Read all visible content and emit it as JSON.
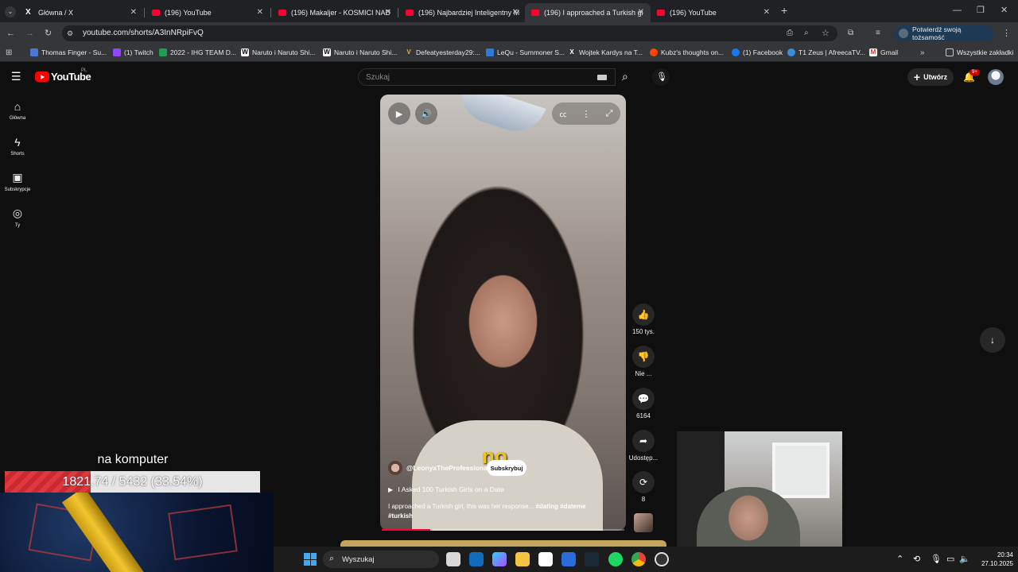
{
  "browser": {
    "tabs": [
      {
        "label": "Główna / X",
        "icon": "x-logo-icon"
      },
      {
        "label": "(196) YouTube",
        "icon": "youtube-icon"
      },
      {
        "label": "(196) Makaljer - KOSMICI NAD",
        "icon": "youtube-icon"
      },
      {
        "label": "(196) Najbardziej Inteligentny M",
        "icon": "youtube-icon"
      },
      {
        "label": "(196) I approached a Turkish gi",
        "icon": "youtube-icon",
        "active": true
      },
      {
        "label": "(196) YouTube",
        "icon": "youtube-icon"
      }
    ],
    "new_tab": "+",
    "url": "youtube.com/shorts/A3InNRpiFvQ",
    "verify_identity": "Potwierdź swoją tożsamość",
    "bookmarks": [
      "Thomas Finger - Su...",
      "(1) Twitch",
      "2022 - IHG TEAM D...",
      "Naruto i Naruto Shi...",
      "Naruto i Naruto Shi...",
      "Defeatyesterday29:...",
      "LeQu - Summoner S...",
      "Wojtek Kardys na T...",
      "Kubz's thoughts on...",
      "(1) Facebook",
      "T1 Zeus | AfreecaTV...",
      "Gmail"
    ],
    "all_bookmarks": "Wszystkie zakładki"
  },
  "youtube": {
    "logo_text": "YouTube",
    "region": "PL",
    "search_placeholder": "Szukaj",
    "create_label": "Utwórz",
    "notif_badge": "9+",
    "nav": [
      {
        "label": "Główna",
        "icon": "home-icon"
      },
      {
        "label": "Shorts",
        "icon": "shorts-icon"
      },
      {
        "label": "Subskrypcje",
        "icon": "subscriptions-icon"
      },
      {
        "label": "Ty",
        "icon": "you-icon"
      }
    ],
    "short": {
      "caption_overlay": "no",
      "channel": "@LeonyxTheProfessional",
      "subscribe": "Subskrybuj",
      "playlist": "I Asked 100 Turkish Girls on a Date",
      "description": "I approached a Turkish girl, this was her response...",
      "hashtags": "#dating #dateme",
      "hashtags2": "#turkish",
      "progress": 0.2
    },
    "actions": {
      "likes": "150 tys.",
      "dislike": "Nie ...",
      "comments": "6164",
      "share": "Udostęp...",
      "remix": "8"
    }
  },
  "stream_overlay": {
    "title": "na komputer",
    "progress_text": "1821.74 / 5432 (33.54%)",
    "progress": 0.3354
  },
  "taskbar": {
    "search_label": "Wyszukaj",
    "time": "20:34",
    "date": "27.10.2025"
  }
}
